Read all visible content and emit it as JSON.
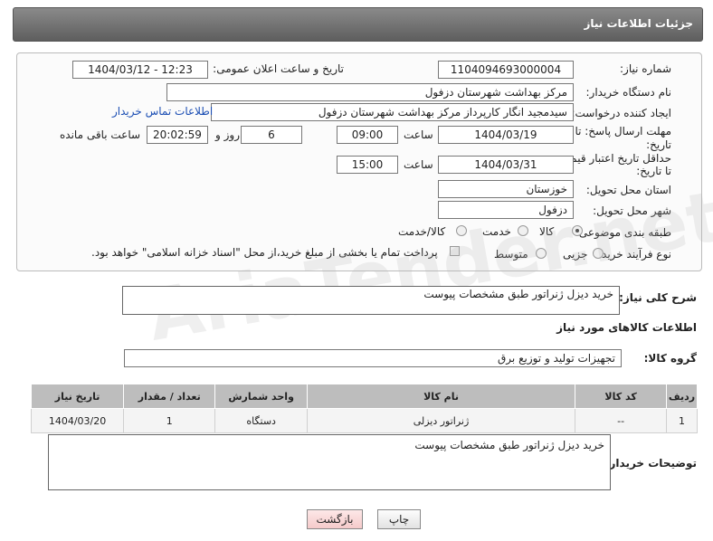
{
  "header": {
    "title": "جزئیات اطلاعات نیاز"
  },
  "form": {
    "need_number_label": "شماره نیاز:",
    "need_number": "1104094693000004",
    "announce_label": "تاریخ و ساعت اعلان عمومی:",
    "announce_value": "1404/03/12 - 12:23",
    "buyer_org_label": "نام دستگاه خریدار:",
    "buyer_org": "مرکز بهداشت شهرستان دزفول",
    "creator_label": "ایجاد کننده درخواست:",
    "creator": "سیدمجید انگار کارپرداز مرکز بهداشت شهرستان دزفول",
    "contact_link": "اطلاعات تماس خریدار",
    "deadline_label_1": "مهلت ارسال پاسخ: تا",
    "deadline_label_2": "تاریخ:",
    "deadline_date": "1404/03/19",
    "time_label": "ساعت",
    "deadline_time": "09:00",
    "days_value": "6",
    "days_label": "روز و",
    "remaining_time": "20:02:59",
    "remaining_label": "ساعت باقی مانده",
    "price_validity_label_1": "حداقل تاریخ اعتبار قیمت:",
    "price_validity_label_2": "تا تاریخ:",
    "price_date": "1404/03/31",
    "price_time": "15:00",
    "province_label": "استان محل تحویل:",
    "province": "خوزستان",
    "city_label": "شهر محل تحویل:",
    "city": "دزفول",
    "category_label": "طبقه بندی موضوعی:",
    "category_options": [
      "کالا",
      "خدمت",
      "کالا/خدمت"
    ],
    "category_selected": "کالا",
    "process_label": "نوع فرآیند خرید :",
    "process_options": [
      "جزیی",
      "متوسط"
    ],
    "process_note": "پرداخت تمام یا بخشی از مبلغ خرید،از محل \"اسناد خزانه اسلامی\" خواهد بود."
  },
  "description": {
    "label": "شرح کلی نیاز:",
    "value": "خرید دیزل ژنراتور طبق مشخصات پیوست"
  },
  "goods_section": {
    "title": "اطلاعات کالاهای مورد نیاز",
    "group_label": "گروه کالا:",
    "group_value": "تجهیزات تولید و توزیع برق"
  },
  "table": {
    "headers": [
      "ردیف",
      "کد کالا",
      "نام کالا",
      "واحد شمارش",
      "تعداد / مقدار",
      "تاریخ نیاز"
    ],
    "rows": [
      [
        "1",
        "--",
        "ژنراتور دیزلی",
        "دستگاه",
        "1",
        "1404/03/20"
      ]
    ]
  },
  "buyer_notes": {
    "label": "توضیحات خریدار:",
    "value": "خرید دیزل ژنراتور طبق مشخصات پیوست"
  },
  "buttons": {
    "print": "چاپ",
    "back": "بازگشت"
  },
  "watermark": "AriaTender.net"
}
